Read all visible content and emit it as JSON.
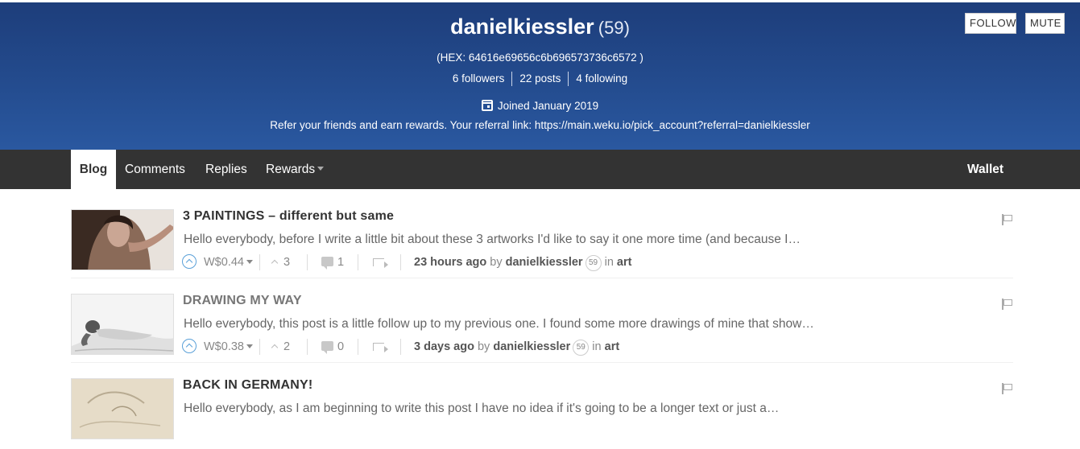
{
  "profile": {
    "username": "danielkiessler",
    "reputation": "(59)",
    "hex": "(HEX: 64616e69656c6b696573736c6572 )",
    "followers": "6 followers",
    "posts": "22 posts",
    "following": "4 following",
    "joined": "Joined January 2019",
    "referral": "Refer your friends and earn rewards. Your referral link: https://main.weku.io/pick_account?referral=danielkiessler"
  },
  "actions": {
    "follow_label": "FOLLOW",
    "mute_label": "MUTE"
  },
  "nav": {
    "blog": "Blog",
    "comments": "Comments",
    "replies": "Replies",
    "rewards": "Rewards",
    "wallet": "Wallet"
  },
  "posts": [
    {
      "title": "3 PAINTINGS – different but same",
      "excerpt": "Hello everybody, before I write a little bit about these 3 artworks I'd like to say it one more time (and because I…",
      "price": "W$0.44",
      "votes": "3",
      "comments": "1",
      "time": "23 hours ago",
      "by": "by",
      "author": "danielkiessler",
      "author_rep": "59",
      "in": "in",
      "category": "art",
      "thumb_icon": "woman-portrait-painting"
    },
    {
      "title": "DRAWING MY WAY",
      "excerpt": "Hello everybody, this post is a little follow up to my previous one. I found some more drawings of mine that show…",
      "price": "W$0.38",
      "votes": "2",
      "comments": "0",
      "time": "3 days ago",
      "by": "by",
      "author": "danielkiessler",
      "author_rep": "59",
      "in": "in",
      "category": "art",
      "thumb_icon": "reclining-figure-drawing"
    },
    {
      "title": "BACK IN GERMANY!",
      "excerpt": "Hello everybody, as I am beginning to write this post I have no idea if it's going to be a longer text or just a…",
      "thumb_icon": "sketch-paper"
    }
  ],
  "colors": {
    "banner_top": "#1d3d7a",
    "banner_bottom": "#2a58a0",
    "navbar": "#333333",
    "upvote_accent": "#5aa0d8"
  }
}
